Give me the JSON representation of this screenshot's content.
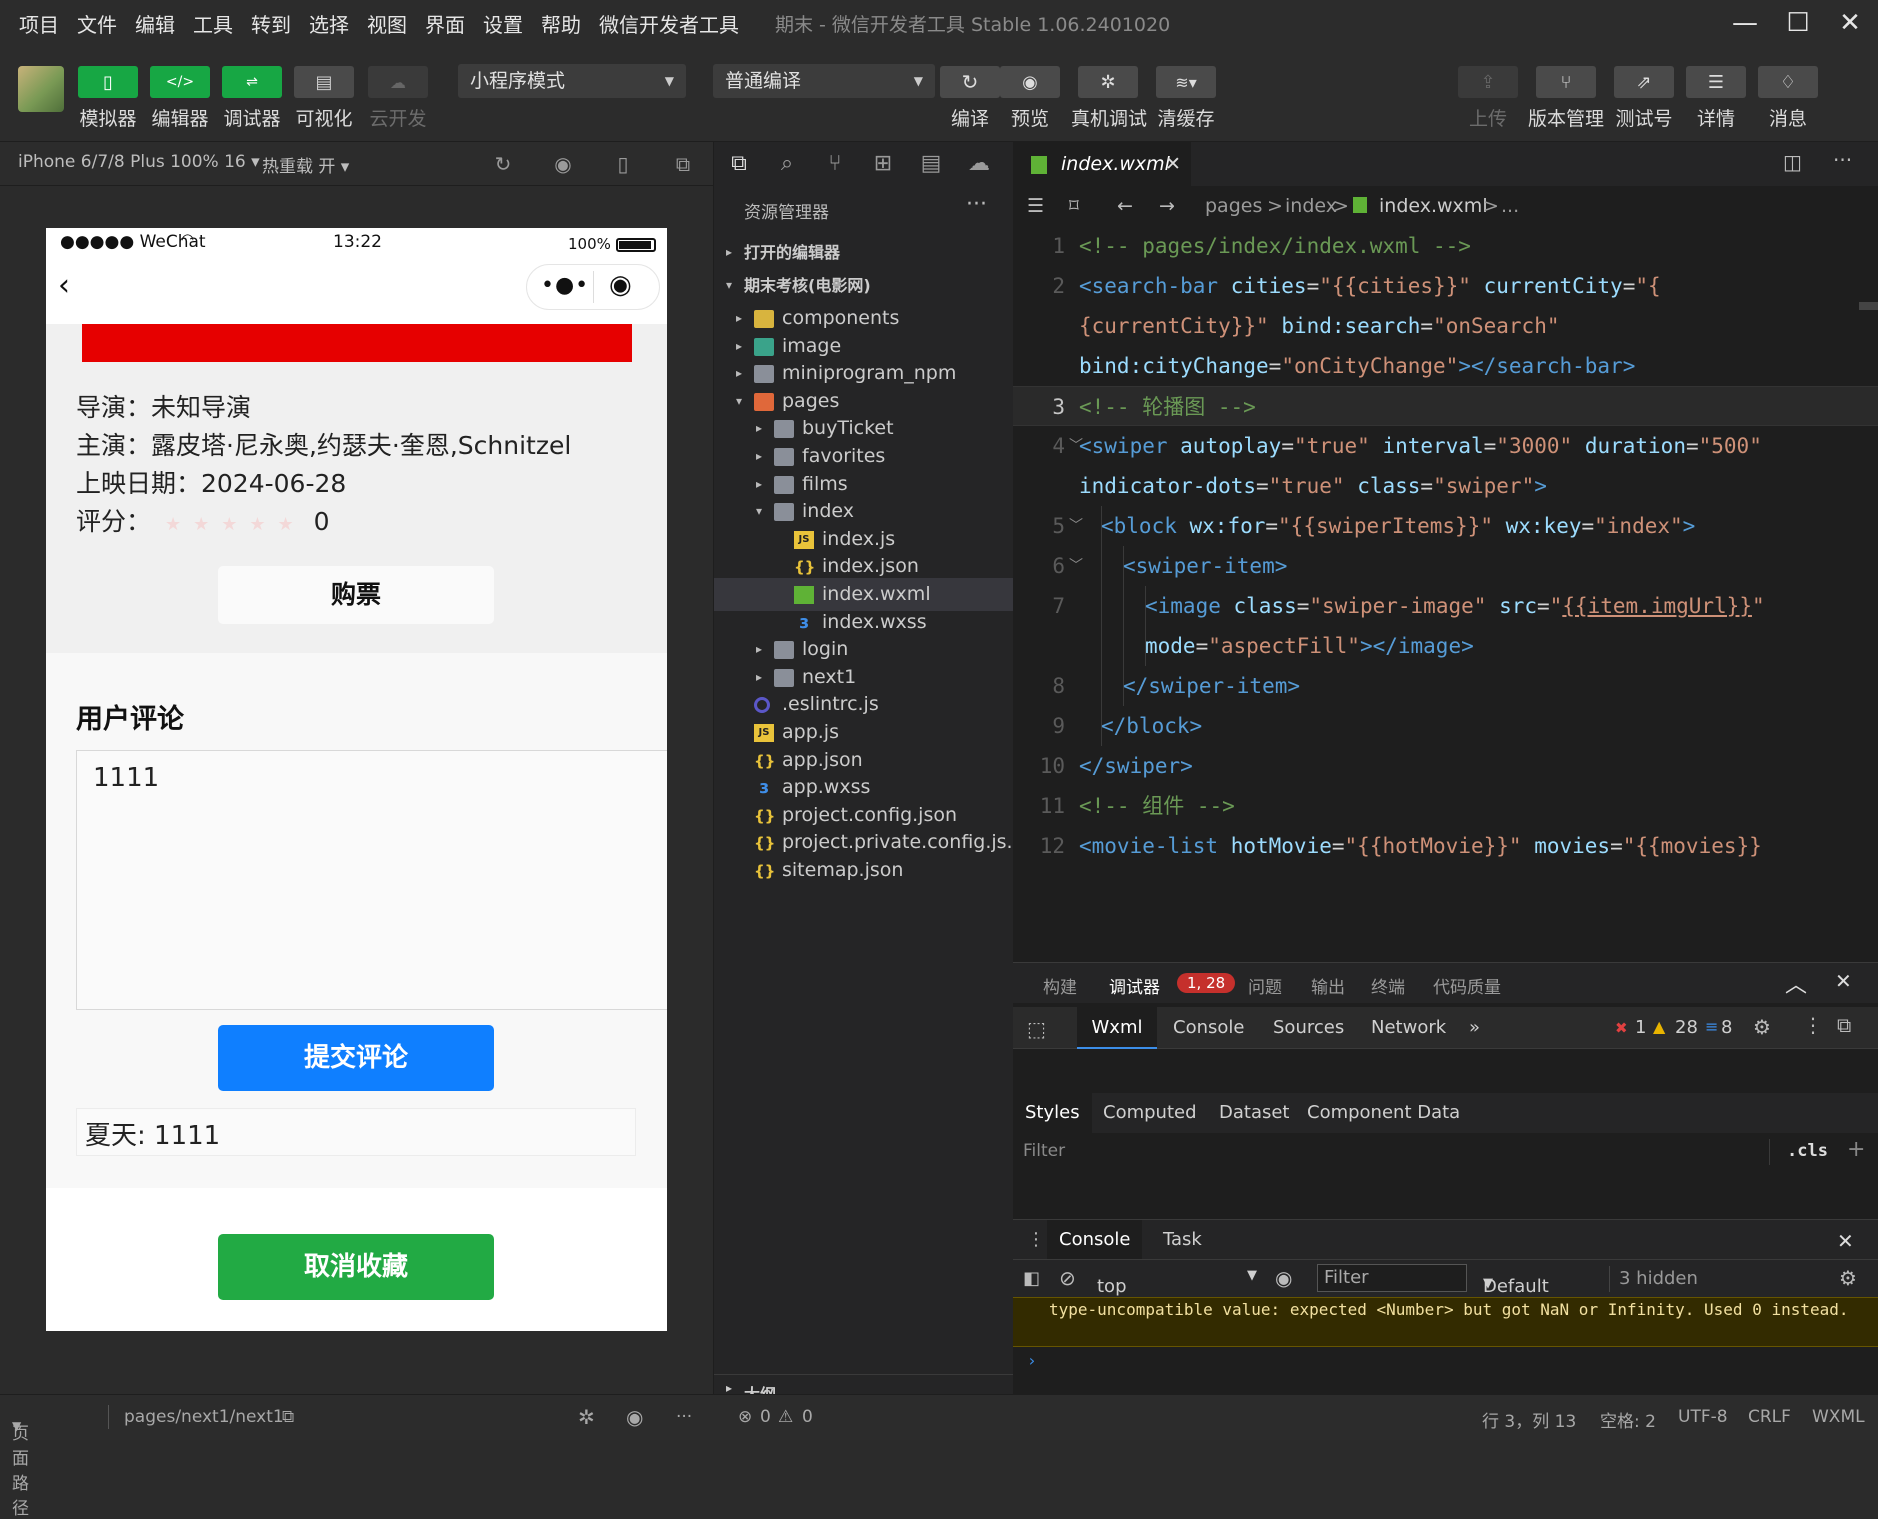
{
  "menubar": {
    "items": [
      "项目",
      "文件",
      "编辑",
      "工具",
      "转到",
      "选择",
      "视图",
      "界面",
      "设置",
      "帮助",
      "微信开发者工具"
    ],
    "window_title": "期末 - 微信开发者工具 Stable 1.06.2401020"
  },
  "toolbar": {
    "left_buttons": [
      {
        "label": "模拟器",
        "icon": "phone-icon"
      },
      {
        "label": "编辑器",
        "icon": "code-icon"
      },
      {
        "label": "调试器",
        "icon": "debug-icon"
      },
      {
        "label": "可视化",
        "icon": "layout-icon"
      },
      {
        "label": "云开发",
        "icon": "cloud-icon"
      }
    ],
    "mode_select": "小程序模式",
    "compile_select": "普通编译",
    "mid_buttons": [
      {
        "label": "编译",
        "icon": "refresh-icon"
      },
      {
        "label": "预览",
        "icon": "eye-icon"
      },
      {
        "label": "真机调试",
        "icon": "bug-icon"
      },
      {
        "label": "清缓存",
        "icon": "layers-icon"
      }
    ],
    "right_buttons": [
      {
        "label": "上传",
        "icon": "upload-icon"
      },
      {
        "label": "版本管理",
        "icon": "branch-icon"
      },
      {
        "label": "测试号",
        "icon": "external-icon"
      },
      {
        "label": "详情",
        "icon": "menu-icon"
      },
      {
        "label": "消息",
        "icon": "bell-icon"
      }
    ]
  },
  "simulator": {
    "device": "iPhone 6/7/8 Plus 100% 16 ▾",
    "hot_reload": "热重载 开 ▾",
    "status": {
      "signal": "●●●●● WeChat",
      "time": "13:22",
      "battery": "100%"
    },
    "movie": {
      "director": "导演：未知导演",
      "actors": "主演：露皮塔·尼永奥,约瑟夫·奎恩,Schnitzel",
      "release": "上映日期：2024-06-28",
      "rating_label": "评分：",
      "rating_value": "0",
      "buy_button": "购票"
    },
    "comments": {
      "title": "用户评论",
      "textarea_value": "1111",
      "submit_button": "提交评论",
      "items": [
        "夏天: 1111"
      ]
    },
    "unfavorite_button": "取消收藏"
  },
  "explorer": {
    "title": "资源管理器",
    "more": "···",
    "open_editors": "打开的编辑器",
    "project": "期末考核(电影网)",
    "tree": [
      {
        "label": "components",
        "type": "folder-yellow",
        "depth": 1,
        "arrow": "▸"
      },
      {
        "label": "image",
        "type": "folder-teal",
        "depth": 1,
        "arrow": "▸"
      },
      {
        "label": "miniprogram_npm",
        "type": "folder",
        "depth": 1,
        "arrow": "▸"
      },
      {
        "label": "pages",
        "type": "folder-orange",
        "depth": 1,
        "arrow": "▾"
      },
      {
        "label": "buyTicket",
        "type": "folder",
        "depth": 2,
        "arrow": "▸"
      },
      {
        "label": "favorites",
        "type": "folder",
        "depth": 2,
        "arrow": "▸"
      },
      {
        "label": "films",
        "type": "folder",
        "depth": 2,
        "arrow": "▸"
      },
      {
        "label": "index",
        "type": "folder",
        "depth": 2,
        "arrow": "▾"
      },
      {
        "label": "index.js",
        "type": "js",
        "depth": 3,
        "arrow": ""
      },
      {
        "label": "index.json",
        "type": "json",
        "depth": 3,
        "arrow": ""
      },
      {
        "label": "index.wxml",
        "type": "wxml",
        "depth": 3,
        "arrow": "",
        "selected": true
      },
      {
        "label": "index.wxss",
        "type": "css",
        "depth": 3,
        "arrow": ""
      },
      {
        "label": "login",
        "type": "folder",
        "depth": 2,
        "arrow": "▸"
      },
      {
        "label": "next1",
        "type": "folder",
        "depth": 2,
        "arrow": "▸"
      },
      {
        "label": ".eslintrc.js",
        "type": "eslint",
        "depth": 1,
        "arrow": ""
      },
      {
        "label": "app.js",
        "type": "js",
        "depth": 1,
        "arrow": ""
      },
      {
        "label": "app.json",
        "type": "json",
        "depth": 1,
        "arrow": ""
      },
      {
        "label": "app.wxss",
        "type": "css",
        "depth": 1,
        "arrow": ""
      },
      {
        "label": "project.config.json",
        "type": "json",
        "depth": 1,
        "arrow": ""
      },
      {
        "label": "project.private.config.js...",
        "type": "json",
        "depth": 1,
        "arrow": ""
      },
      {
        "label": "sitemap.json",
        "type": "json",
        "depth": 1,
        "arrow": ""
      }
    ],
    "outline": "大纲"
  },
  "editor": {
    "tab": "index.wxml",
    "breadcrumb": [
      "pages",
      ">",
      "index",
      ">",
      "index.wxml",
      ">",
      "..."
    ],
    "lines": [
      {
        "n": "1",
        "segs": [
          [
            "c",
            "<!-- pages/index/index.wxml -->"
          ]
        ]
      },
      {
        "n": "2",
        "segs": [
          [
            "t",
            "<search-bar "
          ],
          [
            "a",
            "cities"
          ],
          [
            "p",
            "="
          ],
          [
            "s",
            "\"{{cities}}\""
          ],
          [
            "p",
            " "
          ],
          [
            "a",
            "currentCity"
          ],
          [
            "p",
            "="
          ],
          [
            "s",
            "\"{"
          ]
        ]
      },
      {
        "n": "",
        "segs": [
          [
            "s",
            "{currentCity}}\""
          ],
          [
            "p",
            " "
          ],
          [
            "a",
            "bind:search"
          ],
          [
            "p",
            "="
          ],
          [
            "s",
            "\"onSearch\""
          ]
        ]
      },
      {
        "n": "",
        "segs": [
          [
            "a",
            "bind:cityChange"
          ],
          [
            "p",
            "="
          ],
          [
            "s",
            "\"onCityChange\""
          ],
          [
            "t",
            "></search-bar>"
          ]
        ]
      },
      {
        "n": "3",
        "cur": true,
        "segs": [
          [
            "c",
            "<!-- 轮播图 -->"
          ]
        ]
      },
      {
        "n": "4",
        "fold": true,
        "segs": [
          [
            "t",
            "<swiper "
          ],
          [
            "a",
            "autoplay"
          ],
          [
            "p",
            "="
          ],
          [
            "s",
            "\"true\""
          ],
          [
            "p",
            " "
          ],
          [
            "a",
            "interval"
          ],
          [
            "p",
            "="
          ],
          [
            "s",
            "\"3000\""
          ],
          [
            "p",
            " "
          ],
          [
            "a",
            "duration"
          ],
          [
            "p",
            "="
          ],
          [
            "s",
            "\"500\""
          ]
        ]
      },
      {
        "n": "",
        "segs": [
          [
            "a",
            "indicator-dots"
          ],
          [
            "p",
            "="
          ],
          [
            "s",
            "\"true\""
          ],
          [
            "p",
            " "
          ],
          [
            "a",
            "class"
          ],
          [
            "p",
            "="
          ],
          [
            "s",
            "\"swiper\""
          ],
          [
            "t",
            ">"
          ]
        ]
      },
      {
        "n": "5",
        "fold": true,
        "indent": 1,
        "segs": [
          [
            "t",
            "<block "
          ],
          [
            "a",
            "wx:for"
          ],
          [
            "p",
            "="
          ],
          [
            "s",
            "\"{{swiperItems}}\""
          ],
          [
            "p",
            " "
          ],
          [
            "a",
            "wx:key"
          ],
          [
            "p",
            "="
          ],
          [
            "s",
            "\"index\""
          ],
          [
            "t",
            ">"
          ]
        ]
      },
      {
        "n": "6",
        "fold": true,
        "indent": 2,
        "segs": [
          [
            "t",
            "<swiper-item>"
          ]
        ]
      },
      {
        "n": "7",
        "indent": 3,
        "segs": [
          [
            "t",
            "<image "
          ],
          [
            "a",
            "class"
          ],
          [
            "p",
            "="
          ],
          [
            "s",
            "\"swiper-image\""
          ],
          [
            "p",
            " "
          ],
          [
            "a",
            "src"
          ],
          [
            "p",
            "="
          ],
          [
            "s",
            "\""
          ],
          [
            "l",
            "{{item.imgUrl}}"
          ],
          [
            "s",
            "\""
          ]
        ]
      },
      {
        "n": "",
        "indent": 3,
        "segs": [
          [
            "a",
            "mode"
          ],
          [
            "p",
            "="
          ],
          [
            "s",
            "\"aspectFill\""
          ],
          [
            "t",
            "></image>"
          ]
        ]
      },
      {
        "n": "8",
        "indent": 2,
        "segs": [
          [
            "t",
            "</swiper-item>"
          ]
        ]
      },
      {
        "n": "9",
        "indent": 1,
        "segs": [
          [
            "t",
            "</block>"
          ]
        ]
      },
      {
        "n": "10",
        "segs": [
          [
            "t",
            "</swiper>"
          ]
        ]
      },
      {
        "n": "11",
        "segs": [
          [
            "c",
            "<!-- 组件 -->"
          ]
        ]
      },
      {
        "n": "12",
        "segs": [
          [
            "t",
            "<movie-list "
          ],
          [
            "a",
            "hotMovie"
          ],
          [
            "p",
            "="
          ],
          [
            "s",
            "\"{{hotMovie}}\""
          ],
          [
            "p",
            " "
          ],
          [
            "a",
            "movies"
          ],
          [
            "p",
            "="
          ],
          [
            "s",
            "\"{{movies}}"
          ]
        ]
      }
    ]
  },
  "devtools": {
    "top_tabs": [
      "构建",
      "调试器",
      "问题",
      "输出",
      "终端",
      "代码质量"
    ],
    "debugger_badge": "1, 28",
    "panel_tabs": [
      "Wxml",
      "Console",
      "Sources",
      "Network"
    ],
    "counts": {
      "errors": "1",
      "warnings": "28",
      "info": "8"
    },
    "style_tabs": [
      "Styles",
      "Computed",
      "Dataset",
      "Component Data"
    ],
    "filter_placeholder": "Filter",
    "cls": ".cls",
    "console_tabs": [
      "Console",
      "Task"
    ],
    "context": "top",
    "console_filter": "Filter",
    "levels": "Default levels",
    "hidden": "3 hidden",
    "warning_text": "type-uncompatible value: expected <Number> but got NaN or Infinity. Used 0 instead."
  },
  "statusbar": {
    "page_path_label": "页面路径",
    "page_path": "pages/next1/next1",
    "errors": "0",
    "warnings": "0",
    "cursor": "行 3，列 13",
    "spaces": "空格: 2",
    "encoding": "UTF-8",
    "eol": "CRLF",
    "lang": "WXML"
  }
}
